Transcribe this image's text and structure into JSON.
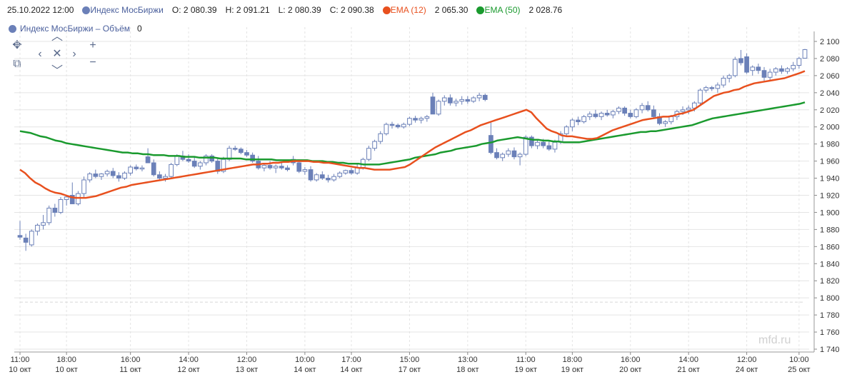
{
  "legend": {
    "datetime": "25.10.2022 12:00",
    "instrument": "Индекс МосБиржи",
    "open": "O: 2 080.39",
    "high": "H: 2 091.21",
    "low": "L: 2 080.39",
    "close": "C: 2 090.38",
    "ema12_label": "EMA (12)",
    "ema12_value": "2 065.30",
    "ema50_label": "EMA (50)",
    "ema50_value": "2 028.76"
  },
  "volume": {
    "label": "Индекс МосБиржи – Объём",
    "value": "0"
  },
  "watermark": "mfd.ru",
  "colors": {
    "candle": "#6b80b8",
    "ema12": "#e8501e",
    "ema50": "#1a9a2e",
    "grid": "#e4e4e4"
  },
  "icons": [
    "move-icon",
    "chevron-up-icon",
    "zoom-in-icon",
    "chevron-left-icon",
    "reset-icon",
    "chevron-right-icon",
    "zoom-region-icon",
    "chevron-down-icon",
    "zoom-out-icon"
  ],
  "chart_data": {
    "type": "candlestick",
    "instrument": "Индекс МосБиржи",
    "interval": "hourly",
    "ylim": [
      1740,
      2100
    ],
    "y_ticks": [
      "2 100",
      "2 080",
      "2 060",
      "2 040",
      "2 020",
      "2 000",
      "1 980",
      "1 960",
      "1 940",
      "1 920",
      "1 900",
      "1 880",
      "1 860",
      "1 840",
      "1 820",
      "1 800",
      "1 780",
      "1 760",
      "1 740"
    ],
    "x_ticks": [
      {
        "time": "11:00",
        "date": "10 окт"
      },
      {
        "time": "18:00",
        "date": "10 окт"
      },
      {
        "time": "16:00",
        "date": "11 окт"
      },
      {
        "time": "14:00",
        "date": "12 окт"
      },
      {
        "time": "12:00",
        "date": "13 окт"
      },
      {
        "time": "10:00",
        "date": "14 окт"
      },
      {
        "time": "17:00",
        "date": "14 окт"
      },
      {
        "time": "15:00",
        "date": "17 окт"
      },
      {
        "time": "13:00",
        "date": "18 окт"
      },
      {
        "time": "11:00",
        "date": "19 окт"
      },
      {
        "time": "18:00",
        "date": "19 окт"
      },
      {
        "time": "16:00",
        "date": "20 окт"
      },
      {
        "time": "14:00",
        "date": "21 окт"
      },
      {
        "time": "12:00",
        "date": "24 окт"
      },
      {
        "time": "10:00",
        "date": "25 окт"
      }
    ],
    "x_tick_bars": [
      0,
      8,
      19,
      29,
      39,
      49,
      57,
      67,
      77,
      87,
      95,
      105,
      115,
      125,
      134
    ],
    "candles": [
      [
        1873,
        1890,
        1868,
        1871
      ],
      [
        1870,
        1875,
        1855,
        1865
      ],
      [
        1862,
        1880,
        1860,
        1878
      ],
      [
        1878,
        1887,
        1873,
        1885
      ],
      [
        1885,
        1897,
        1880,
        1888
      ],
      [
        1888,
        1908,
        1885,
        1905
      ],
      [
        1905,
        1910,
        1895,
        1900
      ],
      [
        1900,
        1918,
        1898,
        1915
      ],
      [
        1915,
        1920,
        1908,
        1918
      ],
      [
        1920,
        1935,
        1910,
        1910
      ],
      [
        1910,
        1925,
        1908,
        1922
      ],
      [
        1922,
        1942,
        1918,
        1938
      ],
      [
        1938,
        1947,
        1935,
        1945
      ],
      [
        1945,
        1950,
        1940,
        1942
      ],
      [
        1942,
        1946,
        1938,
        1945
      ],
      [
        1945,
        1950,
        1942,
        1948
      ],
      [
        1948,
        1952,
        1940,
        1943
      ],
      [
        1943,
        1947,
        1936,
        1940
      ],
      [
        1940,
        1948,
        1938,
        1946
      ],
      [
        1946,
        1955,
        1943,
        1953
      ],
      [
        1953,
        1956,
        1949,
        1951
      ],
      [
        1951,
        1955,
        1948,
        1952
      ],
      [
        1965,
        1975,
        1958,
        1958
      ],
      [
        1958,
        1962,
        1942,
        1944
      ],
      [
        1944,
        1948,
        1938,
        1940
      ],
      [
        1940,
        1945,
        1936,
        1942
      ],
      [
        1942,
        1958,
        1940,
        1956
      ],
      [
        1956,
        1968,
        1954,
        1966
      ],
      [
        1966,
        1972,
        1960,
        1962
      ],
      [
        1962,
        1968,
        1958,
        1960
      ],
      [
        1960,
        1965,
        1952,
        1954
      ],
      [
        1954,
        1960,
        1950,
        1958
      ],
      [
        1958,
        1968,
        1955,
        1966
      ],
      [
        1966,
        1968,
        1958,
        1960
      ],
      [
        1960,
        1964,
        1945,
        1948
      ],
      [
        1948,
        1965,
        1946,
        1962
      ],
      [
        1962,
        1978,
        1960,
        1975
      ],
      [
        1975,
        1978,
        1972,
        1974
      ],
      [
        1974,
        1976,
        1968,
        1970
      ],
      [
        1970,
        1973,
        1965,
        1967
      ],
      [
        1967,
        1970,
        1958,
        1960
      ],
      [
        1960,
        1966,
        1950,
        1952
      ],
      [
        1952,
        1957,
        1948,
        1955
      ],
      [
        1955,
        1960,
        1950,
        1952
      ],
      [
        1952,
        1956,
        1946,
        1954
      ],
      [
        1954,
        1958,
        1950,
        1952
      ],
      [
        1952,
        1955,
        1948,
        1950
      ],
      [
        1962,
        1966,
        1955,
        1958
      ],
      [
        1958,
        1962,
        1946,
        1948
      ],
      [
        1948,
        1953,
        1944,
        1950
      ],
      [
        1950,
        1954,
        1936,
        1938
      ],
      [
        1938,
        1946,
        1936,
        1944
      ],
      [
        1944,
        1948,
        1938,
        1940
      ],
      [
        1940,
        1944,
        1935,
        1938
      ],
      [
        1938,
        1945,
        1936,
        1942
      ],
      [
        1942,
        1948,
        1940,
        1946
      ],
      [
        1946,
        1950,
        1944,
        1949
      ],
      [
        1949,
        1952,
        1944,
        1946
      ],
      [
        1946,
        1956,
        1944,
        1952
      ],
      [
        1952,
        1964,
        1950,
        1962
      ],
      [
        1962,
        1978,
        1960,
        1975
      ],
      [
        1975,
        1985,
        1972,
        1983
      ],
      [
        1983,
        1995,
        1980,
        1992
      ],
      [
        1992,
        2005,
        1990,
        2003
      ],
      [
        2003,
        2006,
        1998,
        2002
      ],
      [
        2002,
        2004,
        1998,
        2000
      ],
      [
        2000,
        2005,
        1998,
        2003
      ],
      [
        2003,
        2012,
        2001,
        2010
      ],
      [
        2010,
        2013,
        2005,
        2008
      ],
      [
        2008,
        2012,
        2004,
        2010
      ],
      [
        2010,
        2014,
        2006,
        2012
      ],
      [
        2035,
        2040,
        2015,
        2015
      ],
      [
        2015,
        2032,
        2013,
        2030
      ],
      [
        2030,
        2037,
        2025,
        2034
      ],
      [
        2034,
        2038,
        2025,
        2028
      ],
      [
        2028,
        2033,
        2024,
        2030
      ],
      [
        2030,
        2036,
        2026,
        2032
      ],
      [
        2032,
        2036,
        2027,
        2030
      ],
      [
        2030,
        2036,
        2028,
        2034
      ],
      [
        2034,
        2040,
        2030,
        2037
      ],
      [
        2037,
        2039,
        2030,
        2032
      ],
      [
        1990,
        2005,
        1968,
        1970
      ],
      [
        1970,
        1975,
        1962,
        1964
      ],
      [
        1964,
        1970,
        1960,
        1968
      ],
      [
        1968,
        1975,
        1965,
        1972
      ],
      [
        1972,
        1976,
        1962,
        1965
      ],
      [
        1965,
        1970,
        1955,
        1968
      ],
      [
        1968,
        1990,
        1966,
        1988
      ],
      [
        1988,
        1990,
        1975,
        1978
      ],
      [
        1978,
        1986,
        1974,
        1982
      ],
      [
        1982,
        1986,
        1975,
        1978
      ],
      [
        1978,
        1983,
        1972,
        1974
      ],
      [
        1974,
        1985,
        1970,
        1982
      ],
      [
        1982,
        1995,
        1980,
        1992
      ],
      [
        1992,
        2002,
        1988,
        2000
      ],
      [
        2000,
        2010,
        1995,
        2008
      ],
      [
        2008,
        2012,
        2002,
        2006
      ],
      [
        2006,
        2014,
        2004,
        2012
      ],
      [
        2012,
        2018,
        2008,
        2015
      ],
      [
        2015,
        2020,
        2010,
        2012
      ],
      [
        2012,
        2018,
        2008,
        2016
      ],
      [
        2016,
        2020,
        2012,
        2014
      ],
      [
        2014,
        2020,
        2010,
        2018
      ],
      [
        2018,
        2024,
        2015,
        2022
      ],
      [
        2022,
        2024,
        2013,
        2016
      ],
      [
        2016,
        2020,
        2010,
        2012
      ],
      [
        2012,
        2022,
        2010,
        2020
      ],
      [
        2020,
        2028,
        2016,
        2025
      ],
      [
        2025,
        2030,
        2018,
        2020
      ],
      [
        2020,
        2025,
        2010,
        2012
      ],
      [
        2012,
        2016,
        2002,
        2004
      ],
      [
        2004,
        2008,
        2000,
        2006
      ],
      [
        2006,
        2014,
        2003,
        2012
      ],
      [
        2012,
        2020,
        2008,
        2018
      ],
      [
        2018,
        2024,
        2014,
        2020
      ],
      [
        2020,
        2025,
        2015,
        2022
      ],
      [
        2022,
        2030,
        2018,
        2028
      ],
      [
        2028,
        2045,
        2026,
        2043
      ],
      [
        2043,
        2048,
        2040,
        2046
      ],
      [
        2046,
        2048,
        2042,
        2045
      ],
      [
        2045,
        2052,
        2040,
        2049
      ],
      [
        2049,
        2060,
        2046,
        2057
      ],
      [
        2057,
        2062,
        2052,
        2060
      ],
      [
        2060,
        2082,
        2058,
        2079
      ],
      [
        2080,
        2090,
        2072,
        2075
      ],
      [
        2082,
        2086,
        2062,
        2064
      ],
      [
        2066,
        2072,
        2060,
        2070
      ],
      [
        2070,
        2074,
        2062,
        2066
      ],
      [
        2066,
        2070,
        2054,
        2058
      ],
      [
        2058,
        2068,
        2054,
        2064
      ],
      [
        2064,
        2070,
        2060,
        2068
      ],
      [
        2068,
        2072,
        2062,
        2065
      ],
      [
        2065,
        2070,
        2062,
        2068
      ],
      [
        2068,
        2076,
        2065,
        2072
      ],
      [
        2072,
        2082,
        2068,
        2080
      ],
      [
        2080.39,
        2091.21,
        2080.39,
        2090.38
      ]
    ],
    "ema12": [
      1950,
      1946,
      1940,
      1935,
      1932,
      1928,
      1925,
      1923,
      1922,
      1920,
      1918,
      1917,
      1917,
      1917,
      1918,
      1919,
      1921,
      1923,
      1925,
      1927,
      1929,
      1930,
      1932,
      1933,
      1934,
      1935,
      1936,
      1937,
      1938,
      1939,
      1940,
      1941,
      1942,
      1943,
      1944,
      1945,
      1946,
      1947,
      1948,
      1949,
      1950,
      1951,
      1952,
      1953,
      1954,
      1955,
      1956,
      1956,
      1957,
      1957,
      1958,
      1958,
      1959,
      1959,
      1960,
      1960,
      1960,
      1960,
      1959,
      1959,
      1958,
      1958,
      1957,
      1956,
      1955,
      1954,
      1953,
      1952,
      1952,
      1951,
      1950,
      1950,
      1950,
      1950,
      1951,
      1952,
      1953,
      1956,
      1960,
      1964,
      1968,
      1972,
      1976,
      1979,
      1982,
      1985,
      1988,
      1991,
      1994,
      1996,
      1999,
      2002,
      2004,
      2006,
      2008,
      2010,
      2012,
      2014,
      2016,
      2018,
      2020,
      2017,
      2010,
      2004,
      1998,
      1995,
      1993,
      1990,
      1989,
      1989,
      1988,
      1987,
      1986,
      1986,
      1987,
      1990,
      1993,
      1996,
      1998,
      2000,
      2002,
      2004,
      2006,
      2008,
      2009,
      2010,
      2011,
      2012,
      2012,
      2013,
      2015,
      2016,
      2018,
      2020,
      2024,
      2028,
      2032,
      2036,
      2038,
      2040,
      2041,
      2043,
      2044,
      2047,
      2049,
      2051,
      2052,
      2053,
      2054,
      2055,
      2056,
      2057,
      2059,
      2061,
      2063,
      2065.3
    ],
    "ema50": [
      1995,
      1994,
      1993,
      1991,
      1989,
      1988,
      1986,
      1984,
      1983,
      1981,
      1980,
      1979,
      1978,
      1977,
      1976,
      1975,
      1974,
      1973,
      1972,
      1971,
      1970,
      1970,
      1969,
      1969,
      1968,
      1968,
      1967,
      1967,
      1967,
      1966,
      1966,
      1966,
      1965,
      1965,
      1965,
      1964,
      1964,
      1964,
      1964,
      1963,
      1963,
      1963,
      1963,
      1963,
      1962,
      1962,
      1962,
      1962,
      1962,
      1962,
      1961,
      1961,
      1961,
      1961,
      1961,
      1961,
      1961,
      1960,
      1960,
      1960,
      1959,
      1959,
      1958,
      1958,
      1957,
      1957,
      1957,
      1956,
      1956,
      1956,
      1956,
      1957,
      1958,
      1959,
      1960,
      1961,
      1962,
      1964,
      1965,
      1966,
      1967,
      1968,
      1970,
      1971,
      1972,
      1974,
      1975,
      1976,
      1977,
      1978,
      1980,
      1981,
      1982,
      1984,
      1985,
      1986,
      1987,
      1988,
      1987,
      1986,
      1985,
      1985,
      1984,
      1984,
      1983,
      1983,
      1982,
      1982,
      1982,
      1982,
      1983,
      1984,
      1985,
      1986,
      1987,
      1988,
      1989,
      1990,
      1991,
      1992,
      1993,
      1994,
      1994,
      1995,
      1995,
      1996,
      1997,
      1998,
      1999,
      2000,
      2001,
      2002,
      2004,
      2006,
      2008,
      2010,
      2011,
      2012,
      2013,
      2014,
      2015,
      2016,
      2017,
      2018,
      2019,
      2020,
      2021,
      2022,
      2023,
      2024,
      2025,
      2026,
      2027,
      2028.76
    ]
  }
}
